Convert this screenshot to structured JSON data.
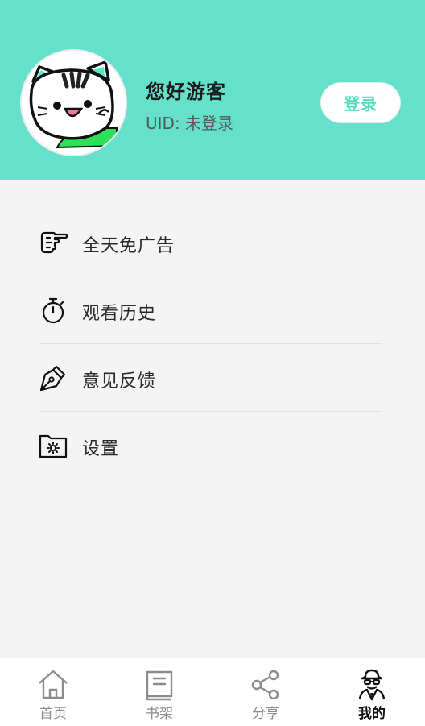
{
  "profile": {
    "greeting": "您好游客",
    "uid": "UID: 未登录",
    "login_label": "登录"
  },
  "colors": {
    "header_bg": "#65e0cb",
    "accent": "#58d8c1"
  },
  "menu": [
    {
      "label": "全天免广告",
      "icon": "pointing-hand-icon"
    },
    {
      "label": "观看历史",
      "icon": "stopwatch-icon"
    },
    {
      "label": "意见反馈",
      "icon": "pen-nib-icon"
    },
    {
      "label": "设置",
      "icon": "settings-folder-icon"
    }
  ],
  "tabs": [
    {
      "label": "首页",
      "icon": "home-icon",
      "active": false
    },
    {
      "label": "书架",
      "icon": "book-icon",
      "active": false
    },
    {
      "label": "分享",
      "icon": "share-icon",
      "active": false
    },
    {
      "label": "我的",
      "icon": "incognito-user-icon",
      "active": true
    }
  ]
}
